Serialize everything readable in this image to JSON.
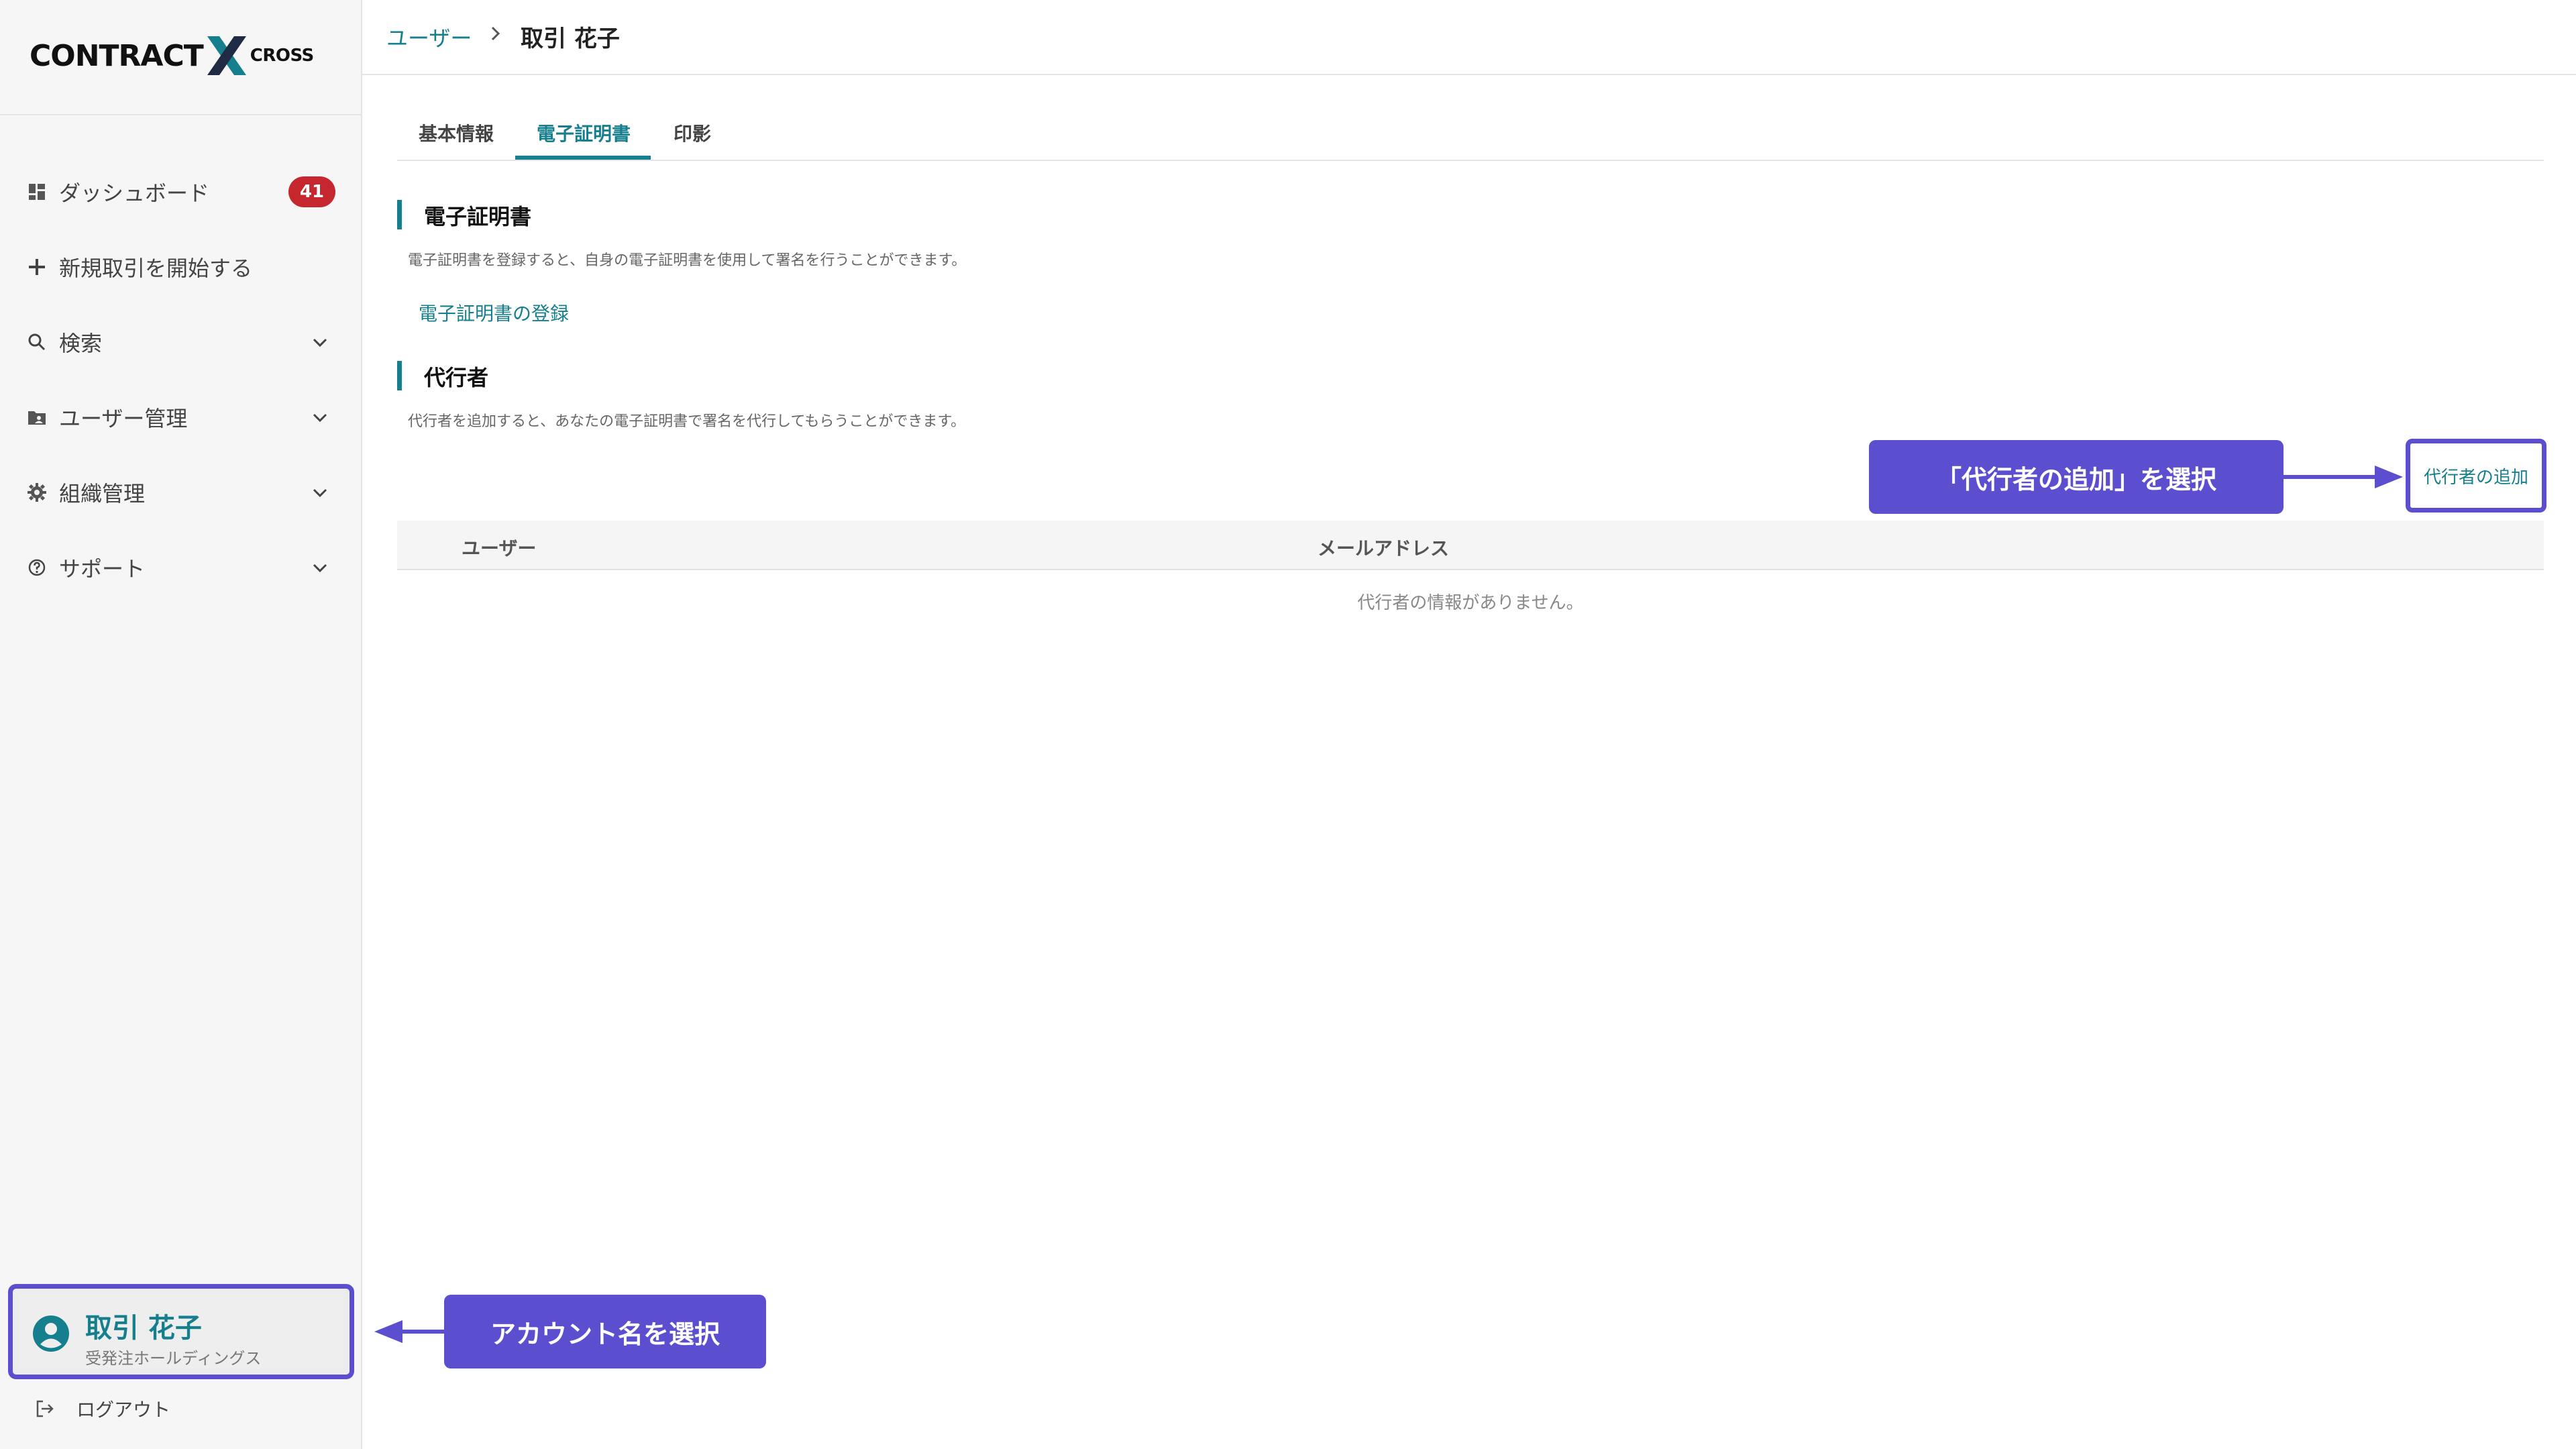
{
  "brand": {
    "logo_main": "CONTRACT",
    "logo_sub": "CROSS",
    "accent": "#167f8e",
    "callout_color": "#5b4fcf",
    "badge_color": "#c6262e"
  },
  "sidebar": {
    "items": [
      {
        "label": "ダッシュボード",
        "icon": "dashboard-icon",
        "badge": "41"
      },
      {
        "label": "新規取引を開始する",
        "icon": "plus-icon"
      },
      {
        "label": "検索",
        "icon": "search-icon",
        "chevron": true
      },
      {
        "label": "ユーザー管理",
        "icon": "folder-user-icon",
        "chevron": true
      },
      {
        "label": "組織管理",
        "icon": "gear-icon",
        "chevron": true
      },
      {
        "label": "サポート",
        "icon": "help-circle-icon",
        "chevron": true
      }
    ],
    "account": {
      "name": "取引 花子",
      "org": "受発注ホールディングス"
    },
    "logout_label": "ログアウト"
  },
  "header": {
    "breadcrumb_link": "ユーザー",
    "breadcrumb_current": "取引 花子"
  },
  "tabs": [
    {
      "label": "基本情報",
      "active": false
    },
    {
      "label": "電子証明書",
      "active": true
    },
    {
      "label": "印影",
      "active": false
    }
  ],
  "certificate": {
    "title": "電子証明書",
    "description": "電子証明書を登録すると、自身の電子証明書を使用して署名を行うことができます。",
    "register_link": "電子証明書の登録"
  },
  "proxy": {
    "title": "代行者",
    "description": "代行者を追加すると、あなたの電子証明書で署名を代行してもらうことができます。",
    "add_button": "代行者の追加",
    "table": {
      "columns": [
        "ユーザー",
        "メールアドレス"
      ],
      "empty_message": "代行者の情報がありません。"
    }
  },
  "callouts": {
    "add_proxy": "「代行者の追加」を選択",
    "account": "アカウント名を選択"
  }
}
